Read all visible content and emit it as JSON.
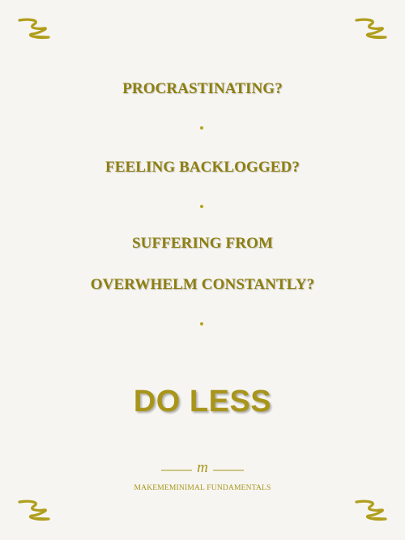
{
  "poster": {
    "questions": [
      "PROCRASTINATING?",
      "FEELING BACKLOGGED?",
      "SUFFERING FROM",
      "OVERWHELM CONSTANTLY?"
    ],
    "headline": "DO LESS",
    "logo_letter": "m",
    "brand": "MAKEMEMINIMAL FUNDAMENTALS"
  },
  "colors": {
    "background": "#f6f5f1",
    "text": "#8e7f10",
    "accent": "#a8951a"
  },
  "decorations": {
    "corner_icon": "squiggle-icon",
    "separator_icon": "dot-icon"
  }
}
